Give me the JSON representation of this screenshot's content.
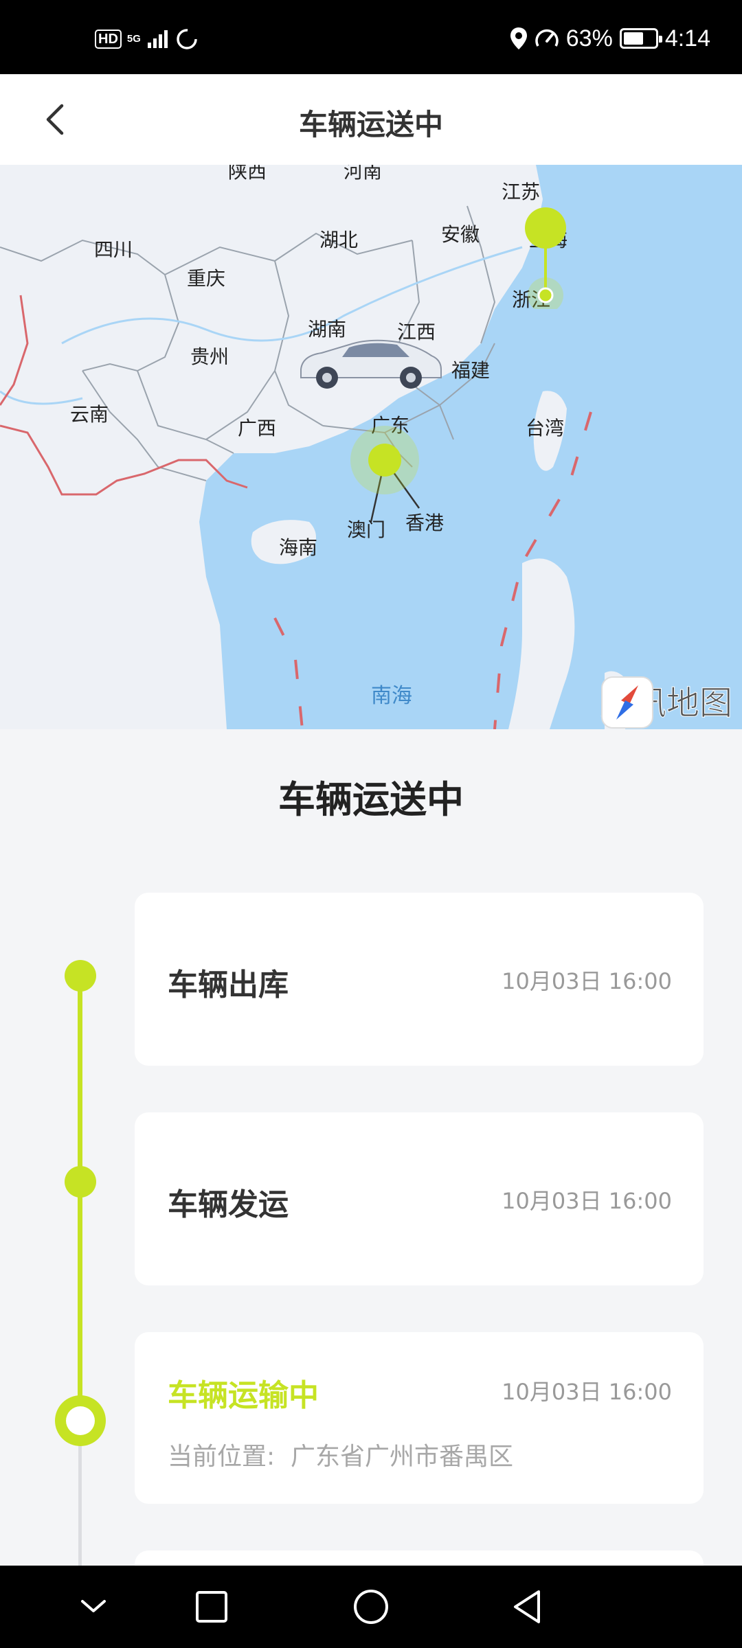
{
  "status_bar": {
    "hd": "HD",
    "network": "5G",
    "battery_text": "63%",
    "battery_level": 0.63,
    "time": "4:14",
    "icons": [
      "signal-icon",
      "loading-icon",
      "location-icon",
      "speed-icon",
      "battery-icon"
    ]
  },
  "header": {
    "title": "车辆运送中"
  },
  "map": {
    "labels": {
      "shaanxi": "陕西",
      "henan": "河南",
      "jiangsu": "江苏",
      "sichuan": "四川",
      "hubei": "湖北",
      "anhui": "安徽",
      "shanghai": "上海",
      "chongqing": "重庆",
      "zhejiang": "浙江",
      "hunan": "湖南",
      "jiangxi": "江西",
      "guizhou": "贵州",
      "fujian": "福建",
      "yunnan": "云南",
      "guangxi": "广西",
      "guangdong": "广东",
      "taiwan": "台湾",
      "macau": "澳门",
      "hongkong": "香港",
      "hainan": "海南",
      "south_sea": "南海"
    },
    "credit": "腾讯地图",
    "marker_color": "#c6e324"
  },
  "section": {
    "title": "车辆运送中"
  },
  "timeline": [
    {
      "label": "车辆出库",
      "time": "10月03日 16:00"
    },
    {
      "label": "车辆发运",
      "time": "10月03日 16:00"
    },
    {
      "label": "车辆运输中",
      "time": "10月03日 16:00",
      "location_label": "当前位置:",
      "location": "广东省广州市番禺区"
    }
  ],
  "colors": {
    "accent": "#c6e324",
    "background": "#f4f5f7",
    "map_water": "#a9d5f6",
    "map_land": "#eef1f6"
  },
  "navbar": {
    "icons": [
      "nav-down-icon",
      "nav-recents-icon",
      "nav-home-icon",
      "nav-back-icon"
    ]
  }
}
